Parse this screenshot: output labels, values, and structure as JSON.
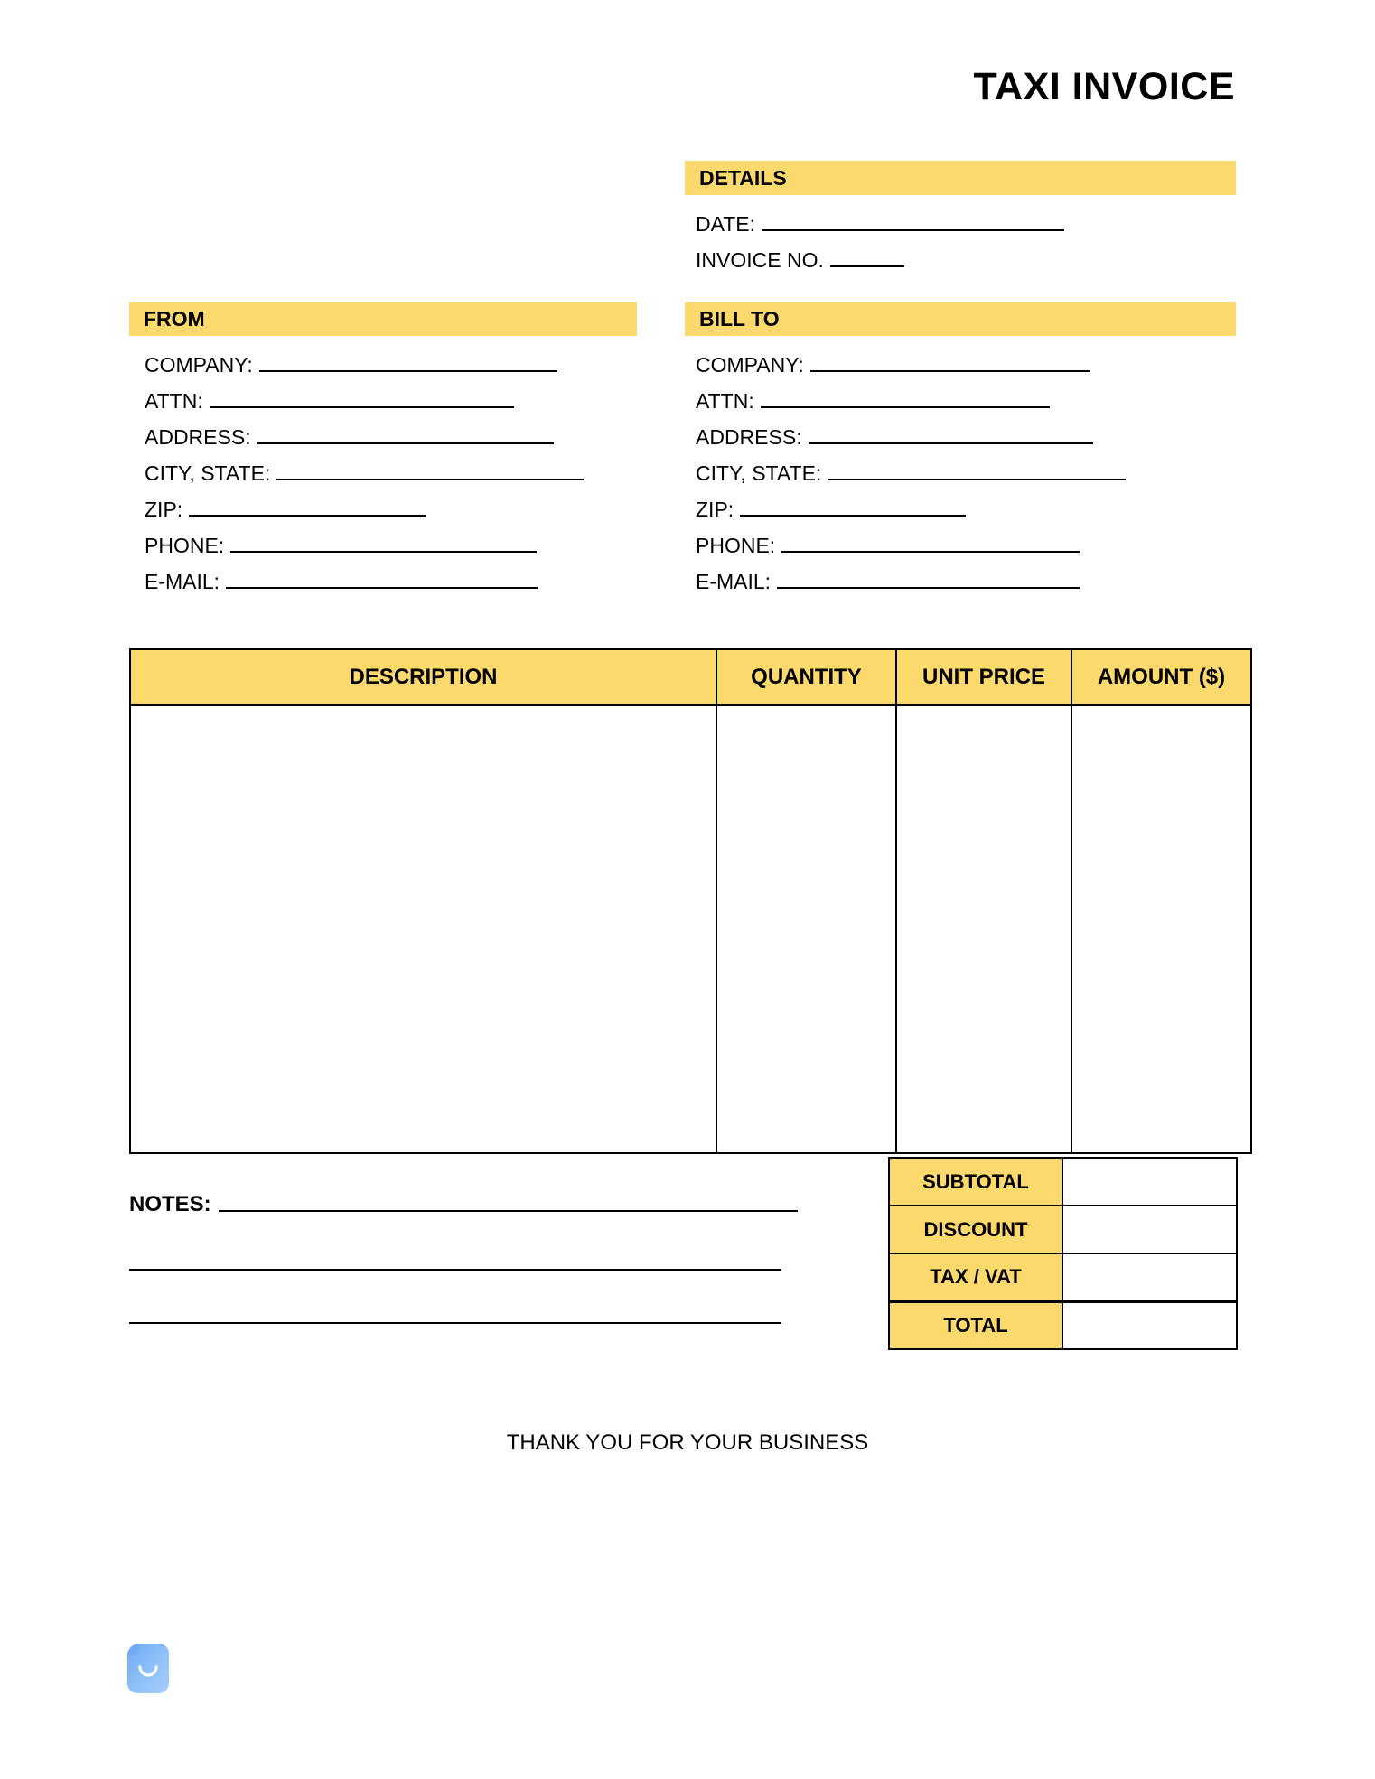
{
  "document": {
    "title": "TAXI INVOICE",
    "accent_color": "#FBD96C",
    "border_color": "#000000",
    "background_color": "#FFFFFF"
  },
  "details": {
    "heading": "DETAILS",
    "fields": [
      {
        "label": "DATE:",
        "value": "",
        "rule_width": 335
      },
      {
        "label": "INVOICE NO.",
        "value": "",
        "rule_width": 82
      }
    ]
  },
  "from": {
    "heading": "FROM",
    "fields": [
      {
        "label": "COMPANY:",
        "value": "",
        "rule_width": 330
      },
      {
        "label": "ATTN:",
        "value": "",
        "rule_width": 337
      },
      {
        "label": "ADDRESS:",
        "value": "",
        "rule_width": 328
      },
      {
        "label": "CITY, STATE:",
        "value": "",
        "rule_width": 340
      },
      {
        "label": "ZIP:",
        "value": "",
        "rule_width": 262
      },
      {
        "label": "PHONE:",
        "value": "",
        "rule_width": 339
      },
      {
        "label": "E-MAIL:",
        "value": "",
        "rule_width": 345
      }
    ]
  },
  "bill_to": {
    "heading": "BILL TO",
    "fields": [
      {
        "label": "COMPANY:",
        "value": "",
        "rule_width": 310
      },
      {
        "label": "ATTN:",
        "value": "",
        "rule_width": 320
      },
      {
        "label": "ADDRESS:",
        "value": "",
        "rule_width": 315
      },
      {
        "label": "CITY, STATE:",
        "value": "",
        "rule_width": 330
      },
      {
        "label": "ZIP:",
        "value": "",
        "rule_width": 250
      },
      {
        "label": "PHONE:",
        "value": "",
        "rule_width": 330
      },
      {
        "label": "E-MAIL:",
        "value": "",
        "rule_width": 335
      }
    ]
  },
  "line_items": {
    "columns": [
      {
        "key": "description",
        "label": "DESCRIPTION"
      },
      {
        "key": "quantity",
        "label": "QUANTITY"
      },
      {
        "key": "unit_price",
        "label": "UNIT PRICE"
      },
      {
        "key": "amount",
        "label": "AMOUNT ($)"
      }
    ],
    "rows": []
  },
  "totals": [
    {
      "label": "SUBTOTAL",
      "value": ""
    },
    {
      "label": "DISCOUNT",
      "value": ""
    },
    {
      "label": "TAX / VAT",
      "value": ""
    },
    {
      "label": "TOTAL",
      "value": ""
    }
  ],
  "notes": {
    "label": "NOTES:",
    "value": "",
    "blank_lines": 2
  },
  "footer": {
    "thanks": "THANK YOU FOR YOUR BUSINESS"
  },
  "logo": {
    "name": "document-smile-logo",
    "color_light": "#A4CDFA",
    "color_dark": "#6FA9F2"
  }
}
